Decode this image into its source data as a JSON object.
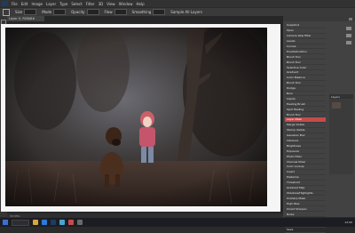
{
  "menubar": {
    "items": [
      "File",
      "Edit",
      "Image",
      "Layer",
      "Type",
      "Select",
      "Filter",
      "3D",
      "View",
      "Window",
      "Help"
    ]
  },
  "optionsbar": {
    "labels": [
      "Size",
      "Mode",
      "Opacity",
      "Flow",
      "Smoothing",
      "Sample All Layers"
    ]
  },
  "document": {
    "tab_label": "Layer 0, RGB/8#",
    "zoom": "33.33%"
  },
  "panel": {
    "history_items": [
      "Snapshot",
      "Open",
      "Camera Raw Filter",
      "Levels",
      "Curves",
      "Hue/Saturation",
      "Brush Tool",
      "Brush Tool",
      "Selective Color",
      "Gradient",
      "Color Balance",
      "Brush Tool",
      "Dodge",
      "Burn",
      "Liquify",
      "Healing Brush",
      "Spot Healing",
      "Brush Tool",
      "Layer Mask",
      "Merge Visible",
      "Stamp Visible",
      "Gaussian Blur",
      "Vibrance",
      "Brightness",
      "Exposure",
      "Photo Filter",
      "Channel Mixer",
      "Color Lookup",
      "Invert",
      "Posterize",
      "Threshold",
      "Gradient Map",
      "Shadows/Highlights",
      "Unsharp Mask",
      "High Pass",
      "Smart Sharpen",
      "Noise",
      "Crop",
      "Flatten",
      "Save"
    ],
    "selected_index": 18,
    "layers_header": "Layers"
  },
  "taskbar": {
    "clock": "12:00"
  },
  "colors": {
    "accent_selected": "#c84b4b",
    "panel_bg": "#424242",
    "canvas_bg": "#262626"
  }
}
